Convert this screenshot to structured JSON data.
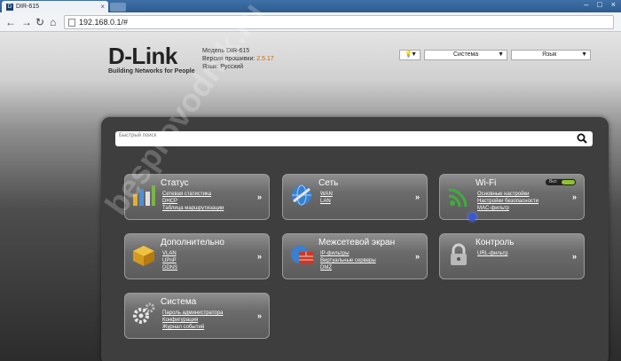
{
  "browser": {
    "tab_title": "DIR-615",
    "favicon_letter": "D",
    "url": "192.168.0.1/#"
  },
  "header": {
    "logo_text": "D-Link",
    "logo_tagline": "Building Networks for People",
    "model_label": "Модель DIR-615",
    "firmware_label": "Версия прошивки:",
    "firmware_version": "2.5.17",
    "language_label": "Язык: Русский",
    "system_select": "Система",
    "language_select": "Язык"
  },
  "search": {
    "placeholder": "Быстрый поиск"
  },
  "tiles": {
    "status": {
      "title": "Статус",
      "links": [
        "Сетевая статистика",
        "DHCP",
        "Таблица маршрутизации"
      ]
    },
    "network": {
      "title": "Сеть",
      "links": [
        "WAN",
        "LAN"
      ]
    },
    "wifi": {
      "title": "Wi-Fi",
      "toggle_label": "Вкл",
      "links": [
        "Основные настройки",
        "Настройки безопасности",
        "MAC-фильтр"
      ]
    },
    "advanced": {
      "title": "Дополнительно",
      "links": [
        "VLAN",
        "UPnP",
        "DDNS"
      ]
    },
    "firewall": {
      "title": "Межсетевой экран",
      "links": [
        "IP-фильтры",
        "Виртуальные серверы",
        "DMZ"
      ]
    },
    "control": {
      "title": "Контроль",
      "links": [
        "URL-фильтр"
      ]
    },
    "system": {
      "title": "Система",
      "links": [
        "Пароль администратора",
        "Конфигурация",
        "Журнал событий"
      ]
    }
  },
  "watermark": "besprovodnik.ru",
  "colors": {
    "brand_dark": "#222222",
    "wifi_green": "#3fae3a",
    "accent_orange": "#c86a00"
  }
}
